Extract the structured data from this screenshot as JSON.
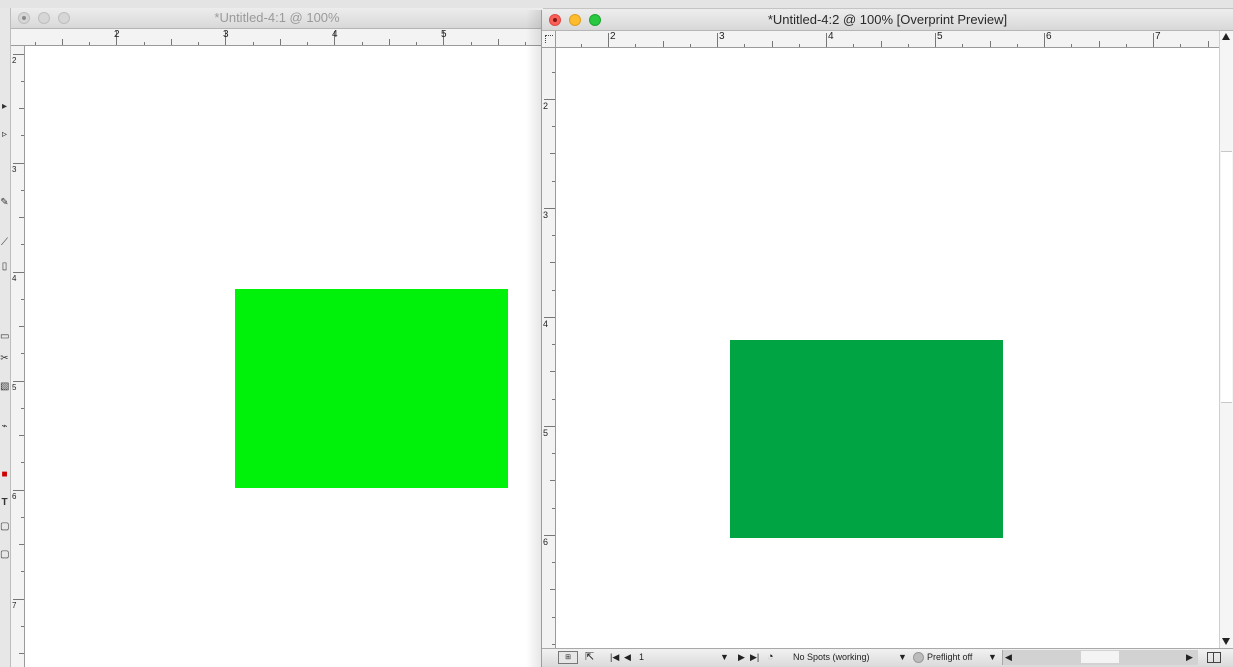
{
  "window_back": {
    "title": "*Untitled-4:1 @ 100%",
    "ruler_h": [
      "2",
      "3",
      "4",
      "5"
    ],
    "ruler_v": [
      "2",
      "3",
      "4",
      "5",
      "6",
      "7"
    ],
    "shape_color": "#00f20a"
  },
  "window_front": {
    "title": "*Untitled-4:2 @ 100% [Overprint Preview]",
    "ruler_h": [
      "2",
      "3",
      "4",
      "5",
      "6",
      "7"
    ],
    "ruler_v": [
      "2",
      "3",
      "4",
      "5",
      "6"
    ],
    "shape_color": "#00a443",
    "status": {
      "page_number": "1",
      "spots_label": "No Spots (working)",
      "preflight_label": "Preflight off"
    }
  },
  "tools": {
    "type_tool_glyph": "T"
  },
  "colors": {
    "accent_close": "#fc5f57",
    "accent_minimize": "#fdbc2e",
    "accent_maximize": "#28c840"
  }
}
